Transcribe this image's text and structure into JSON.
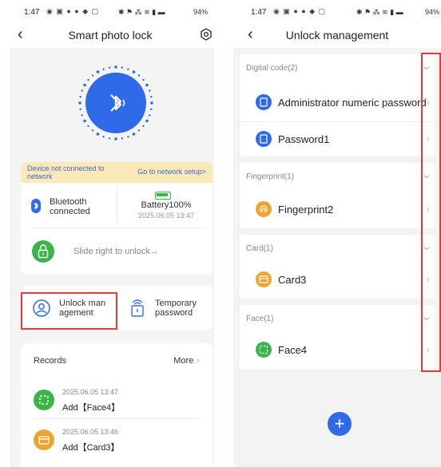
{
  "colors": {
    "accent": "#2f6be9",
    "green": "#3bb54a",
    "orange": "#f0a430",
    "highlight": "#e53935",
    "banner_bg": "#fbe9b8"
  },
  "left": {
    "status": {
      "time": "1:47",
      "right": "94%"
    },
    "title": "Smart photo lock",
    "banner": {
      "message": "Device not connected to network",
      "link": "Go to network setup>"
    },
    "bluetooth_status": "Bluetooth connected",
    "battery": {
      "level": "Battery100%",
      "updated": "2025.06.05 13:47"
    },
    "slide_text": "Slide right to unlock→",
    "features": {
      "unlock_management": "Unlock man agement",
      "temporary_password": "Temporary password"
    },
    "records": {
      "title": "Records",
      "more": "More",
      "items": [
        {
          "date": "2025.06.05 13:47",
          "text": "Add【Face4】",
          "icon": "face-icon"
        },
        {
          "date": "2025.06.05 13:46",
          "text": "Add【Card3】",
          "icon": "card-icon"
        }
      ]
    }
  },
  "right": {
    "status": {
      "time": "1:47",
      "right": "94%"
    },
    "title": "Unlock management",
    "groups": [
      {
        "title": "Digital code(2)",
        "items": [
          "Administrator numeric password",
          "Password1"
        ]
      },
      {
        "title": "Fingerprint(1)",
        "items": [
          "Fingerprint2"
        ]
      },
      {
        "title": "Card(1)",
        "items": [
          "Card3"
        ]
      },
      {
        "title": "Face(1)",
        "items": [
          "Face4"
        ]
      }
    ],
    "add_label": "+"
  }
}
